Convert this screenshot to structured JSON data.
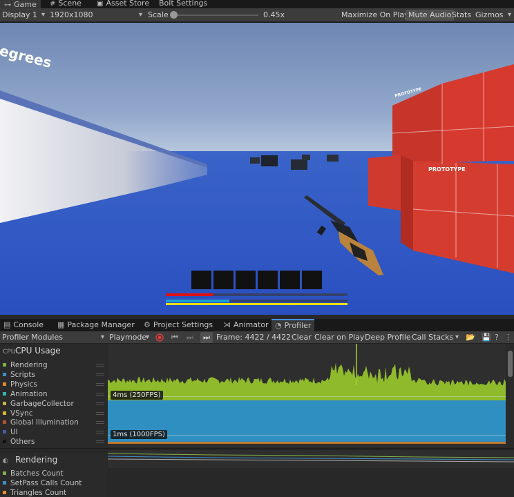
{
  "top_tabs": [
    {
      "label": "Game",
      "icon": "gamepad-icon",
      "active": true
    },
    {
      "label": "Scene",
      "icon": "grid-icon",
      "active": false
    },
    {
      "label": "Asset Store",
      "icon": "store-icon",
      "active": false
    },
    {
      "label": "Bolt Settings",
      "icon": "",
      "active": false
    }
  ],
  "game_toolbar": {
    "display": "Display 1",
    "resolution": "1920x1080",
    "scale_label": "Scale",
    "scale_value": "0.45x",
    "scale_fraction": 0.0,
    "maximize_on_play": "Maximize On Play",
    "mute_audio": "Mute Audio",
    "stats": "Stats",
    "gizmos": "Gizmos"
  },
  "game_view": {
    "overlay_text": "egrees",
    "prototype_label": "PROTOTYPE",
    "colors": {
      "sky_top": "#6e87b3",
      "sky_horizon": "#aebfd8",
      "sea": "#2f56c7",
      "box_red": "#d63a2e",
      "health": "#e01010",
      "stamina": "#1aa0d0",
      "ammo": "#f0e000"
    },
    "hotbar_slots": 6,
    "health_fraction": 0.26,
    "stamina_fraction": 0.35,
    "ammo_fraction": 1.0
  },
  "bottom_tabs": [
    {
      "label": "Console",
      "icon": "console-icon",
      "active": false
    },
    {
      "label": "Package Manager",
      "icon": "package-icon",
      "active": false
    },
    {
      "label": "Project Settings",
      "icon": "gear-icon",
      "active": false
    },
    {
      "label": "Animator",
      "icon": "animator-icon",
      "active": false
    },
    {
      "label": "Profiler",
      "icon": "profiler-icon",
      "active": true
    }
  ],
  "profiler_toolbar": {
    "modules": "Profiler Modules",
    "mode": "Playmode",
    "frame": "Frame: 4422 / 4422",
    "clear": "Clear",
    "clear_on_play": "Clear on Play",
    "deep_profile": "Deep Profile",
    "call_stacks": "Call Stacks"
  },
  "cpu_module": {
    "title": "CPU Usage",
    "icon_text": "CPU",
    "items": [
      {
        "label": "Rendering",
        "color": "#7fb24a"
      },
      {
        "label": "Scripts",
        "color": "#3f8ec8"
      },
      {
        "label": "Physics",
        "color": "#e08a2a"
      },
      {
        "label": "Animation",
        "color": "#35b6b0"
      },
      {
        "label": "GarbageCollector",
        "color": "#c5b34a"
      },
      {
        "label": "VSync",
        "color": "#d7b52c"
      },
      {
        "label": "Global Illumination",
        "color": "#b5522e"
      },
      {
        "label": "UI",
        "color": "#4b58a8"
      },
      {
        "label": "Others",
        "color": "#111111"
      }
    ],
    "marker_4ms": "4ms (250FPS)",
    "marker_1ms": "1ms (1000FPS)"
  },
  "rendering_module": {
    "title": "Rendering",
    "items": [
      {
        "label": "Batches Count",
        "color": "#7fb24a"
      },
      {
        "label": "SetPass Calls Count",
        "color": "#3f8ec8"
      },
      {
        "label": "Triangles Count",
        "color": "#e08a2a"
      }
    ]
  }
}
